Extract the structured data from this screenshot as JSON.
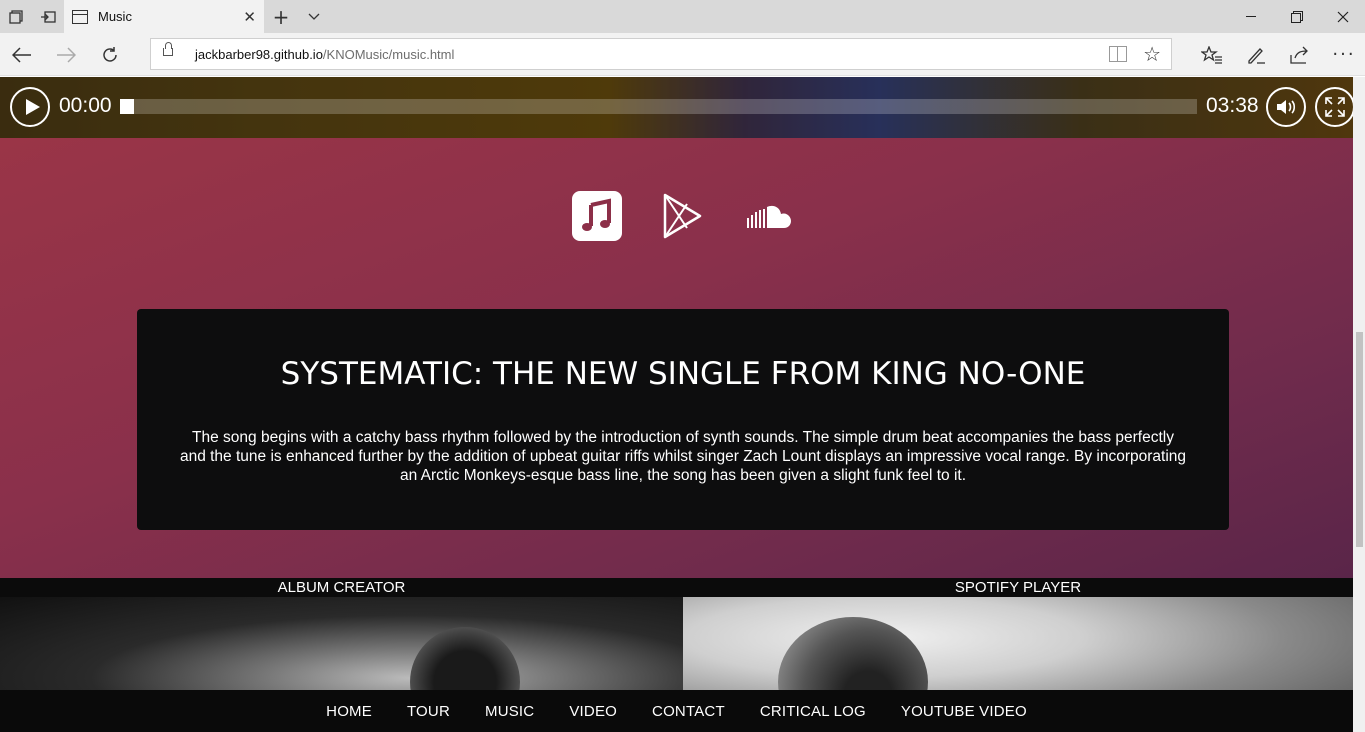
{
  "browser": {
    "tab_title": "Music",
    "url_host": "jackbarber98.github.io",
    "url_path": "/KNOMusic/music.html"
  },
  "player": {
    "current_time": "00:00",
    "duration": "03:38",
    "progress": 0.0
  },
  "store_icons": [
    "itunes-music-icon",
    "google-play-icon",
    "soundcloud-icon"
  ],
  "card": {
    "title": "SYSTEMATIC: THE NEW SINGLE FROM KING NO-ONE",
    "body": "The song begins with a catchy bass rhythm followed by the introduction of synth sounds. The simple drum beat accompanies the bass perfectly and the tune is enhanced further by the addition of upbeat guitar riffs whilst singer Zach Lount displays an impressive vocal range. By incorporating an Arctic Monkeys-esque bass line, the song has been given a slight funk feel to it."
  },
  "sections": {
    "left_label": "ALBUM CREATOR",
    "right_label": "SPOTIFY PLAYER"
  },
  "nav": {
    "items": [
      "HOME",
      "TOUR",
      "MUSIC",
      "VIDEO",
      "CONTACT",
      "CRITICAL LOG",
      "YOUTUBE VIDEO"
    ]
  },
  "colors": {
    "hero_top": "#9a3547",
    "hero_bottom": "#5a2549",
    "card_bg": "#0d0d0e",
    "nav_bg": "#0a0a0a"
  }
}
